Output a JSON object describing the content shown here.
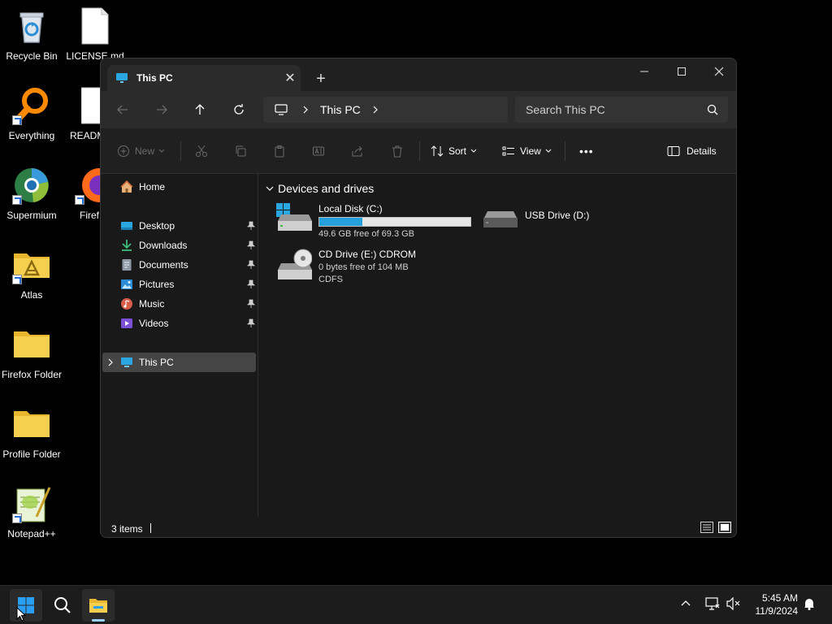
{
  "desktop": {
    "icons": [
      {
        "label": "Recycle Bin"
      },
      {
        "label": "LICENSE.md"
      },
      {
        "label": "Everything"
      },
      {
        "label": "READM"
      },
      {
        "label": "Supermium"
      },
      {
        "label": "Firef"
      },
      {
        "label": "Atlas"
      },
      {
        "label": "Firefox Folder"
      },
      {
        "label": "Profile Folder"
      },
      {
        "label": "Notepad++"
      }
    ]
  },
  "window": {
    "tab_title": "This PC",
    "tab_close": "✕",
    "new_tab": "+",
    "address": {
      "crumbs": [
        "This PC"
      ]
    },
    "search": {
      "placeholder": "Search This PC"
    },
    "toolbar": {
      "new_label": "New",
      "sort_label": "Sort",
      "view_label": "View",
      "more_label": "•••",
      "details_label": "Details"
    },
    "sidebar": {
      "home": "Home",
      "quick_access": [
        {
          "label": "Desktop",
          "icon": "desktop-icon"
        },
        {
          "label": "Downloads",
          "icon": "downloads-icon"
        },
        {
          "label": "Documents",
          "icon": "documents-icon"
        },
        {
          "label": "Pictures",
          "icon": "pictures-icon"
        },
        {
          "label": "Music",
          "icon": "music-icon"
        },
        {
          "label": "Videos",
          "icon": "videos-icon"
        }
      ],
      "this_pc": "This PC"
    },
    "content": {
      "group_header": "Devices and drives",
      "drives": [
        {
          "name": "Local Disk (C:)",
          "free_text": "49.6 GB free of 69.3 GB",
          "used_fraction": 0.284
        },
        {
          "name": "USB Drive (D:)"
        },
        {
          "name": "CD Drive (E:) CDROM",
          "free_text": "0 bytes free of 104 MB",
          "filesystem": "CDFS"
        }
      ]
    },
    "status": {
      "items_count": "3 items"
    }
  },
  "taskbar": {
    "time": "5:45 AM",
    "date": "11/9/2024"
  },
  "colors": {
    "accent": "#26a0da",
    "window_bg": "#191919",
    "toolbar_bg": "#202020",
    "nav_bg": "#2b2b2b",
    "selection": "#454545"
  }
}
